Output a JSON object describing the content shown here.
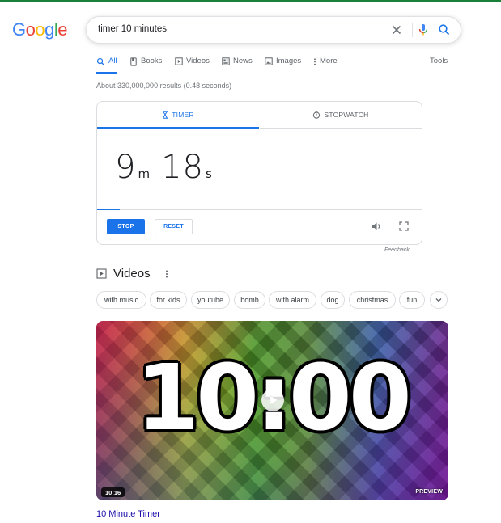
{
  "header": {
    "logo_letters": [
      "G",
      "o",
      "o",
      "g",
      "l",
      "e"
    ],
    "query": "timer 10 minutes"
  },
  "tabs": [
    {
      "label": "All",
      "icon": "search-icon",
      "active": true
    },
    {
      "label": "Books",
      "icon": "book-icon",
      "active": false
    },
    {
      "label": "Videos",
      "icon": "video-icon",
      "active": false
    },
    {
      "label": "News",
      "icon": "news-icon",
      "active": false
    },
    {
      "label": "Images",
      "icon": "image-icon",
      "active": false
    },
    {
      "label": "More",
      "icon": "more-vert-icon",
      "active": false
    }
  ],
  "tools_label": "Tools",
  "result_stats": "About 330,000,000 results (0.48 seconds)",
  "timer": {
    "tab_timer": "TIMER",
    "tab_stopwatch": "STOPWATCH",
    "minutes": "9",
    "minutes_unit": "m",
    "seconds": "18",
    "seconds_unit": "s",
    "stop_label": "STOP",
    "reset_label": "RESET",
    "feedback": "Feedback"
  },
  "videos": {
    "heading": "Videos",
    "chips": [
      "with music",
      "for kids",
      "youtube",
      "bomb",
      "with alarm",
      "dog",
      "christmas",
      "fun"
    ],
    "thumbnail_text": "10:00",
    "duration": "10:16",
    "preview_label": "PREVIEW",
    "title": "10 Minute Timer"
  },
  "colors": {
    "accent_blue": "#1a73e8",
    "link": "#1a0dab",
    "top_accent": "#188038"
  }
}
